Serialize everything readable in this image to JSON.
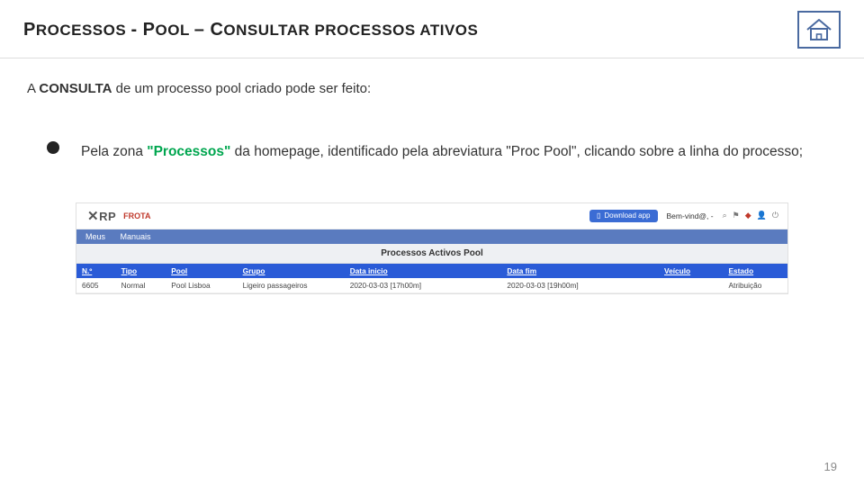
{
  "header": {
    "title_prefix": "P",
    "title_rest1": "ROCESSOS ",
    "dash1": "- ",
    "title_p2a": "P",
    "title_p2b": "OOL ",
    "dash2": "– ",
    "title_p3a": "C",
    "title_p3b": "ONSULTAR PROCESSOS ATIVOS"
  },
  "intro": {
    "pre": "A ",
    "strong": "CONSULTA",
    "post": " de um processo pool criado pode ser feito:"
  },
  "bullet": {
    "t1": "Pela zona ",
    "green": "\"Processos\"",
    "t2": " da homepage, identificado pela abreviatura \"Proc Pool\", clicando sobre a linha do processo;"
  },
  "screenshot": {
    "brand": "XRP",
    "brand_sub": "FROTA",
    "download": "Download app",
    "welcome": "Bem-vind@, -",
    "nav": {
      "item1": "Meus",
      "item2": "Manuais"
    },
    "section_title": "Processos Activos Pool",
    "columns": [
      "N.º",
      "Tipo",
      "Pool",
      "Grupo",
      "Data inicio",
      "Data fim",
      "Veículo",
      "Estado"
    ],
    "row": {
      "num": "6605",
      "tipo": "Normal",
      "pool": "Pool Lisboa",
      "grupo": "Ligeiro passageiros",
      "inicio": "2020-03-03 [17h00m]",
      "fim": "2020-03-03 [19h00m]",
      "veiculo": "",
      "estado": "Atribuição"
    }
  },
  "page_number": "19"
}
